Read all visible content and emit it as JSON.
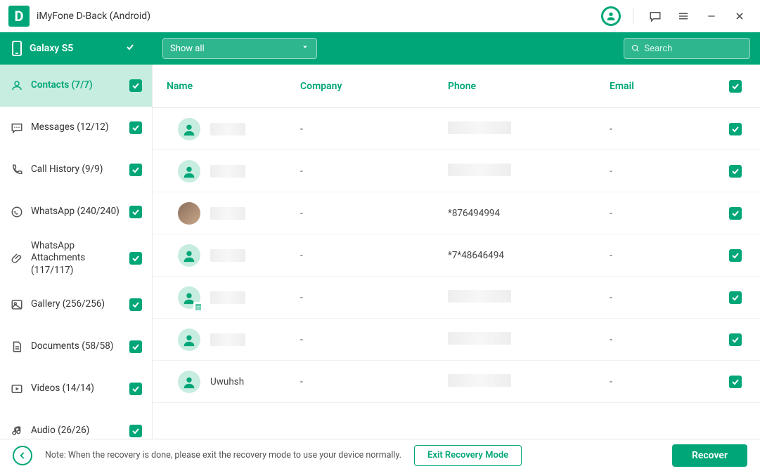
{
  "titlebar": {
    "app_name": "iMyFone D-Back (Android)"
  },
  "toolbar": {
    "device_name": "Galaxy S5",
    "filter_label": "Show all",
    "search_placeholder": "Search"
  },
  "sidebar": {
    "items": [
      {
        "icon": "contact",
        "label": "Contacts (7/7)",
        "active": true
      },
      {
        "icon": "message",
        "label": "Messages (12/12)",
        "active": false
      },
      {
        "icon": "phone",
        "label": "Call History (9/9)",
        "active": false
      },
      {
        "icon": "whatsapp",
        "label": "WhatsApp (240/240)",
        "active": false
      },
      {
        "icon": "clip",
        "label": "WhatsApp Attachments (117/117)",
        "active": false,
        "tall": true
      },
      {
        "icon": "gallery",
        "label": "Gallery (256/256)",
        "active": false
      },
      {
        "icon": "document",
        "label": "Documents (58/58)",
        "active": false
      },
      {
        "icon": "video",
        "label": "Videos (14/14)",
        "active": false
      },
      {
        "icon": "audio",
        "label": "Audio (26/26)",
        "active": false
      }
    ]
  },
  "table": {
    "headers": {
      "name": "Name",
      "company": "Company",
      "phone": "Phone",
      "email": "Email"
    },
    "rows": [
      {
        "name_blur": true,
        "avatar": "default",
        "company": "-",
        "phone_blur": true,
        "phone": "",
        "email": "-",
        "checked": true
      },
      {
        "name_blur": true,
        "avatar": "default",
        "company": "-",
        "phone_blur": true,
        "phone": "",
        "email": "-",
        "checked": true
      },
      {
        "name_blur": true,
        "avatar": "photo",
        "company": "-",
        "phone_blur": false,
        "phone": "*876494994",
        "email": "-",
        "checked": true
      },
      {
        "name_blur": true,
        "avatar": "default",
        "company": "-",
        "phone_blur": false,
        "phone": "*7*48646494",
        "email": "-",
        "checked": true
      },
      {
        "name_blur": true,
        "avatar": "deleted",
        "company": "-",
        "phone_blur": true,
        "phone": "",
        "email": "-",
        "checked": true
      },
      {
        "name_blur": true,
        "avatar": "default",
        "company": "-",
        "phone_blur": true,
        "phone": "",
        "email": "-",
        "checked": true
      },
      {
        "name_blur": false,
        "name": "Uwuhsh",
        "avatar": "default",
        "company": "-",
        "phone_blur": true,
        "phone": "",
        "email": "-",
        "checked": true
      }
    ]
  },
  "footer": {
    "note": "Note: When the recovery is done, please exit the recovery mode to use your device normally.",
    "exit_label": "Exit Recovery Mode",
    "recover_label": "Recover"
  }
}
